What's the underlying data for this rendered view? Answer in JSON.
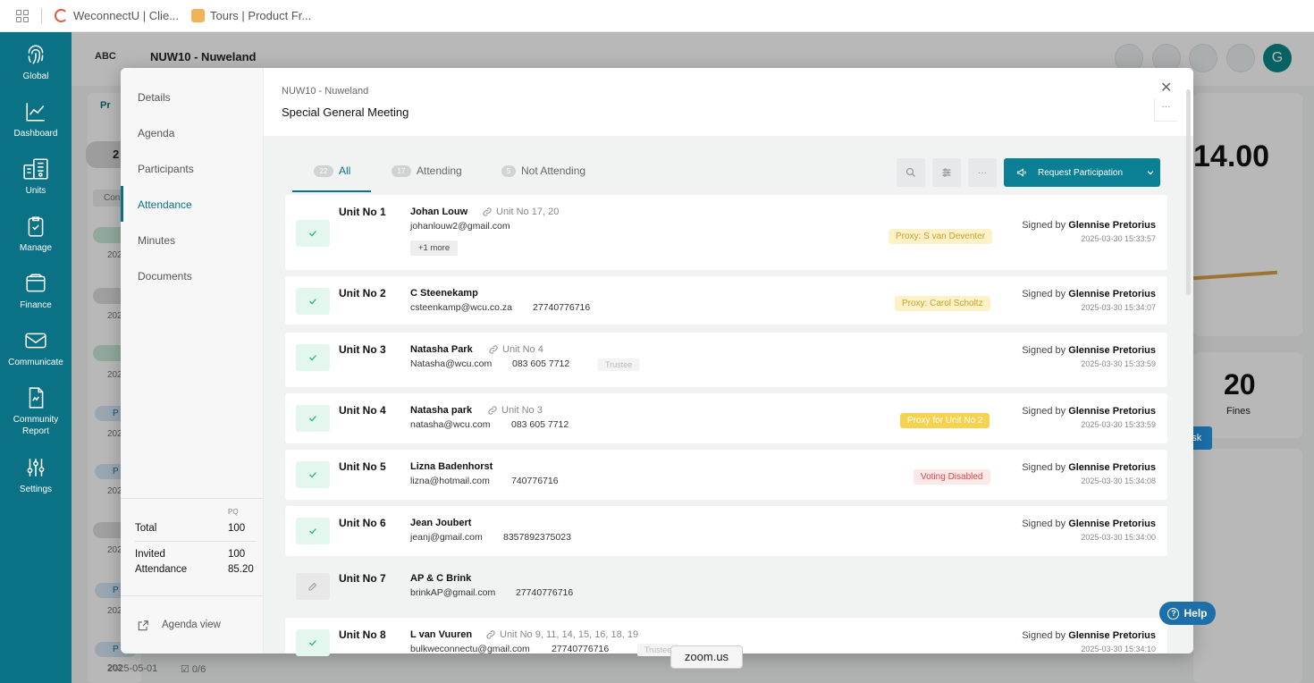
{
  "browser": {
    "tabs": [
      "WeconnectU | Clie...",
      "Tours | Product Fr..."
    ]
  },
  "app_nav": [
    {
      "label": "Global",
      "icon": "fingerprint-icon"
    },
    {
      "label": "Dashboard",
      "icon": "chart-line-icon"
    },
    {
      "label": "Units",
      "icon": "building-icon"
    },
    {
      "label": "Manage",
      "icon": "clipboard-check-icon"
    },
    {
      "label": "Finance",
      "icon": "wallet-icon"
    },
    {
      "label": "Communicate",
      "icon": "mail-icon"
    },
    {
      "label": "Community Report",
      "icon": "report-icon"
    },
    {
      "label": "Settings",
      "icon": "sliders-icon"
    }
  ],
  "background": {
    "logo": "ABC",
    "title": "NUW10 - Nuweland",
    "avatar_initial": "G",
    "stat_value": "14.00",
    "fines_count": "20",
    "fines_label": "Fines",
    "add_task": "Add Task",
    "pills": [
      "Pr",
      "2",
      "Con",
      "P",
      "P",
      "P",
      "P"
    ],
    "dates": [
      "202",
      "202",
      "202",
      "202",
      "202",
      "202",
      "202",
      "202",
      "2025-05-01"
    ],
    "checklist": "0/6",
    "help": "Help"
  },
  "modal": {
    "crumb": "NUW10 - Nuweland",
    "title": "Special General Meeting",
    "more_label": "···",
    "sidebar": {
      "items": [
        "Details",
        "Agenda",
        "Participants",
        "Attendance",
        "Minutes",
        "Documents"
      ],
      "pq_label": "PQ",
      "total_label": "Total",
      "total_value": "100",
      "invited_label": "Invited",
      "invited_value": "100",
      "attendance_label": "Attendance",
      "attendance_value": "85.20",
      "agenda_view": "Agenda view"
    },
    "tabs": [
      {
        "count": "22",
        "label": "All"
      },
      {
        "count": "17",
        "label": "Attending"
      },
      {
        "count": "5",
        "label": "Not Attending"
      }
    ],
    "tool_more": "···",
    "request_label": "Request Participation",
    "signed_prefix": "Signed by",
    "rows": [
      {
        "unit": "Unit No 1",
        "name": "Johan Louw",
        "link": "Unit No 17, 20",
        "email": "johanlouw2@gmail.com",
        "phone": "",
        "more": "+1 more",
        "badge": "Proxy: S van Deventer",
        "signer": "Glennise Pretorius",
        "time": "2025-03-30 15:33:57"
      },
      {
        "unit": "Unit No 2",
        "name": "C Steenekamp",
        "email": "csteenkamp@wcu.co.za",
        "phone": "27740776716",
        "badge": "Proxy: Carol Scholtz",
        "signer": "Glennise Pretorius",
        "time": "2025-03-30 15:34:07"
      },
      {
        "unit": "Unit No 3",
        "name": "Natasha Park",
        "link": "Unit No 4",
        "email": "Natasha@wcu.com",
        "phone": "083 605 7712",
        "tag": "Trustee",
        "signer": "Glennise Pretorius",
        "time": "2025-03-30 15:33:59"
      },
      {
        "unit": "Unit No 4",
        "name": "Natasha park",
        "link": "Unit No 3",
        "email": "natasha@wcu.com",
        "phone": "083 605 7712",
        "badge": "Proxy for Unit No 2",
        "signer": "Glennise Pretorius",
        "time": "2025-03-30 15:33:59"
      },
      {
        "unit": "Unit No 5",
        "name": "Lizna Badenhorst",
        "email": "lizna@hotmail.com",
        "phone": "740776716",
        "badge": "Voting Disabled",
        "signer": "Glennise Pretorius",
        "time": "2025-03-30 15:34:08"
      },
      {
        "unit": "Unit No 6",
        "name": "Jean Joubert",
        "email": "jeanj@gmail.com",
        "phone": "8357892375023",
        "signer": "Glennise Pretorius",
        "time": "2025-03-30 15:34:00"
      },
      {
        "unit": "Unit No 7",
        "name": "AP & C Brink",
        "email": "brinkAP@gmail.com",
        "phone": "27740776716"
      },
      {
        "unit": "Unit No 8",
        "name": "L van Vuuren",
        "link": "Unit No 9, 11, 14, 15, 16, 18, 19",
        "email": "bulkweconnectu@gmail.com",
        "phone": "27740776716",
        "tag": "Trustee",
        "signer": "Glennise Pretorius",
        "time": "2025-03-30 15:34:10"
      }
    ]
  },
  "tooltip": "zoom.us",
  "colors": {
    "accent": "#0b7285",
    "check_bg": "#e3f7ef",
    "proxy_bg": "#fdf1c8",
    "proxy_for_bg": "#f6d24f",
    "voting_disabled_bg": "#fde8e8"
  }
}
